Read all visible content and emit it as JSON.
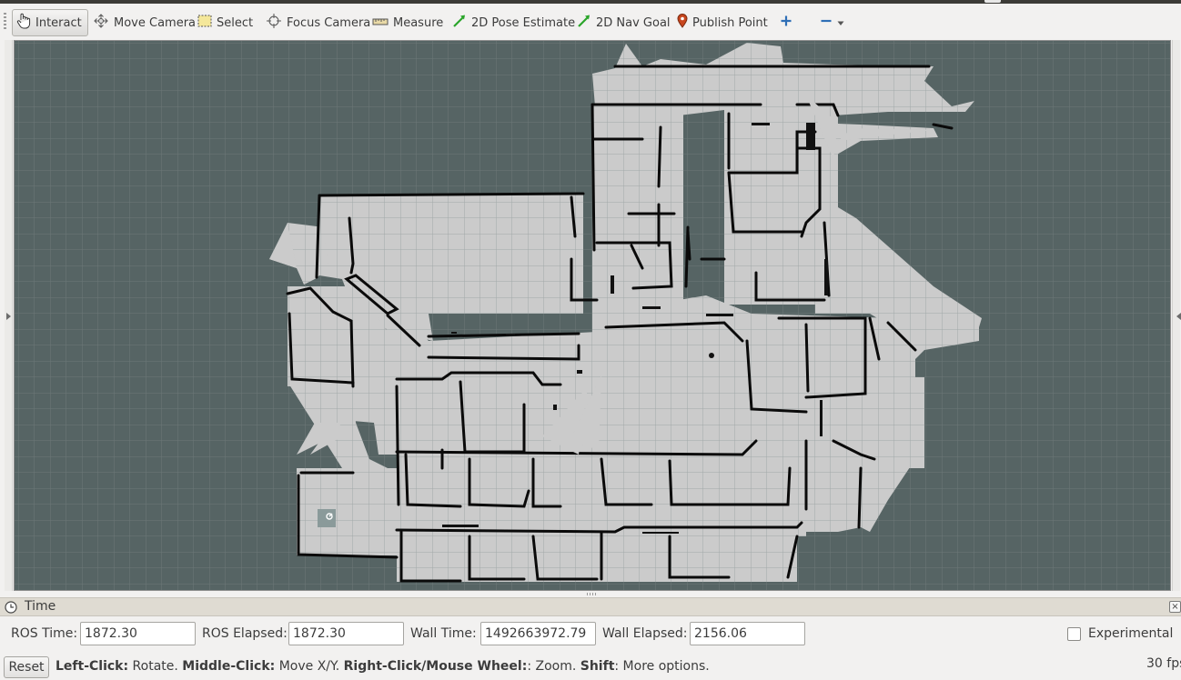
{
  "toolbar": {
    "tools": [
      {
        "label": "Interact",
        "icon": "hand-pointer-icon",
        "active": true
      },
      {
        "label": "Move Camera",
        "icon": "move-camera-icon"
      },
      {
        "label": "Select",
        "icon": "select-box-icon"
      },
      {
        "label": "Focus Camera",
        "icon": "crosshair-icon"
      },
      {
        "label": "Measure",
        "icon": "ruler-icon"
      },
      {
        "label": "2D Pose Estimate",
        "icon": "green-arrow-icon"
      },
      {
        "label": "2D Nav Goal",
        "icon": "green-arrow-icon"
      },
      {
        "label": "Publish Point",
        "icon": "map-pin-icon"
      }
    ],
    "add_icon": "plus-icon",
    "remove_icon": "minus-icon",
    "accent_color": "#2f6fb6",
    "goal_color": "#2aa52a",
    "pin_color": "#c8461e"
  },
  "viewport": {
    "background_color": "#566464",
    "free_space_color": "#cbcbcb",
    "obstacle_color": "#0a0a0a",
    "grid_color": "#7f8b8b"
  },
  "time_panel": {
    "title": "Time",
    "ros_time_label": "ROS Time:",
    "ros_time_value": "1872.30",
    "ros_elapsed_label": "ROS Elapsed:",
    "ros_elapsed_value": "1872.30",
    "wall_time_label": "Wall Time:",
    "wall_time_value": "1492663972.79",
    "wall_elapsed_label": "Wall Elapsed:",
    "wall_elapsed_value": "2156.06",
    "experimental_label": "Experimental",
    "experimental_checked": false
  },
  "status": {
    "reset_label": "Reset",
    "left_click_key": "Left-Click:",
    "left_click_desc": " Rotate. ",
    "middle_click_key": "Middle-Click:",
    "middle_click_desc": " Move X/Y. ",
    "right_click_key": "Right-Click/Mouse Wheel:",
    "right_click_desc": ": Zoom. ",
    "shift_key": "Shift",
    "shift_desc": ": More options.",
    "fps": "30 fps"
  }
}
